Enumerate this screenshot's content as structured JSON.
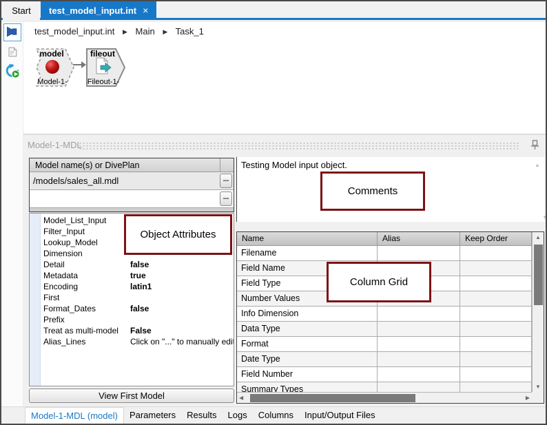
{
  "colors": {
    "accent_blue": "#1878c8",
    "annotation_red": "#7c1215",
    "node_red": "#b41414",
    "fileout_teal": "#3aa9ad"
  },
  "top_tabs": {
    "start_label": "Start",
    "active_label": "test_model_input.int",
    "close_glyph": "×"
  },
  "breadcrumb": {
    "items": [
      "test_model_input.int",
      "Main",
      "Task_1"
    ],
    "separator_glyph": "▶"
  },
  "canvas": {
    "nodes": [
      {
        "type_label": "model",
        "instance_label": "Model-1-"
      },
      {
        "type_label": "fileout",
        "instance_label": "Fileout-1-"
      }
    ]
  },
  "panel": {
    "title": "Model-1-MDL",
    "model_grid": {
      "header_label": "Model name(s) or DivePlan",
      "row1_value": "/models/sales_all.mdl",
      "row2_value": "",
      "browse_label": "..."
    },
    "attributes": [
      {
        "label": "Model_List_Input",
        "value": ""
      },
      {
        "label": "Filter_Input",
        "value": ""
      },
      {
        "label": "Lookup_Model",
        "value": ""
      },
      {
        "label": "Dimension",
        "value": ""
      },
      {
        "label": "Detail",
        "value": "false"
      },
      {
        "label": "Metadata",
        "value": "true"
      },
      {
        "label": "Encoding",
        "value": "latin1"
      },
      {
        "label": "First",
        "value": ""
      },
      {
        "label": "Format_Dates",
        "value": "false"
      },
      {
        "label": "Prefix",
        "value": ""
      },
      {
        "label": "Treat as multi-model",
        "value": "False"
      },
      {
        "label": "Alias_Lines",
        "value": "Click on \"...\" to manually edit the"
      }
    ],
    "view_first_model_button": "View First Model",
    "comments_text": "Testing Model input object.",
    "column_grid": {
      "headers": [
        "Name",
        "Alias",
        "Keep Order"
      ],
      "row_names": [
        "Filename",
        "Field Name",
        "Field Type",
        "Number Values",
        "Info Dimension",
        "Data Type",
        "Format",
        "Date Type",
        "Field Number",
        "Summary Types"
      ]
    }
  },
  "annotations": {
    "object_attributes_label": "Object Attributes",
    "comments_label": "Comments",
    "column_grid_label": "Column Grid"
  },
  "bottom_tabs": {
    "items": [
      {
        "label": "Model-1-MDL (model)"
      },
      {
        "label": "Parameters"
      },
      {
        "label": "Results"
      },
      {
        "label": "Logs"
      },
      {
        "label": "Columns"
      },
      {
        "label": "Input/Output Files"
      }
    ]
  },
  "glyphs": {
    "up": "▲",
    "down": "▼",
    "left": "◀",
    "right": "▶"
  }
}
